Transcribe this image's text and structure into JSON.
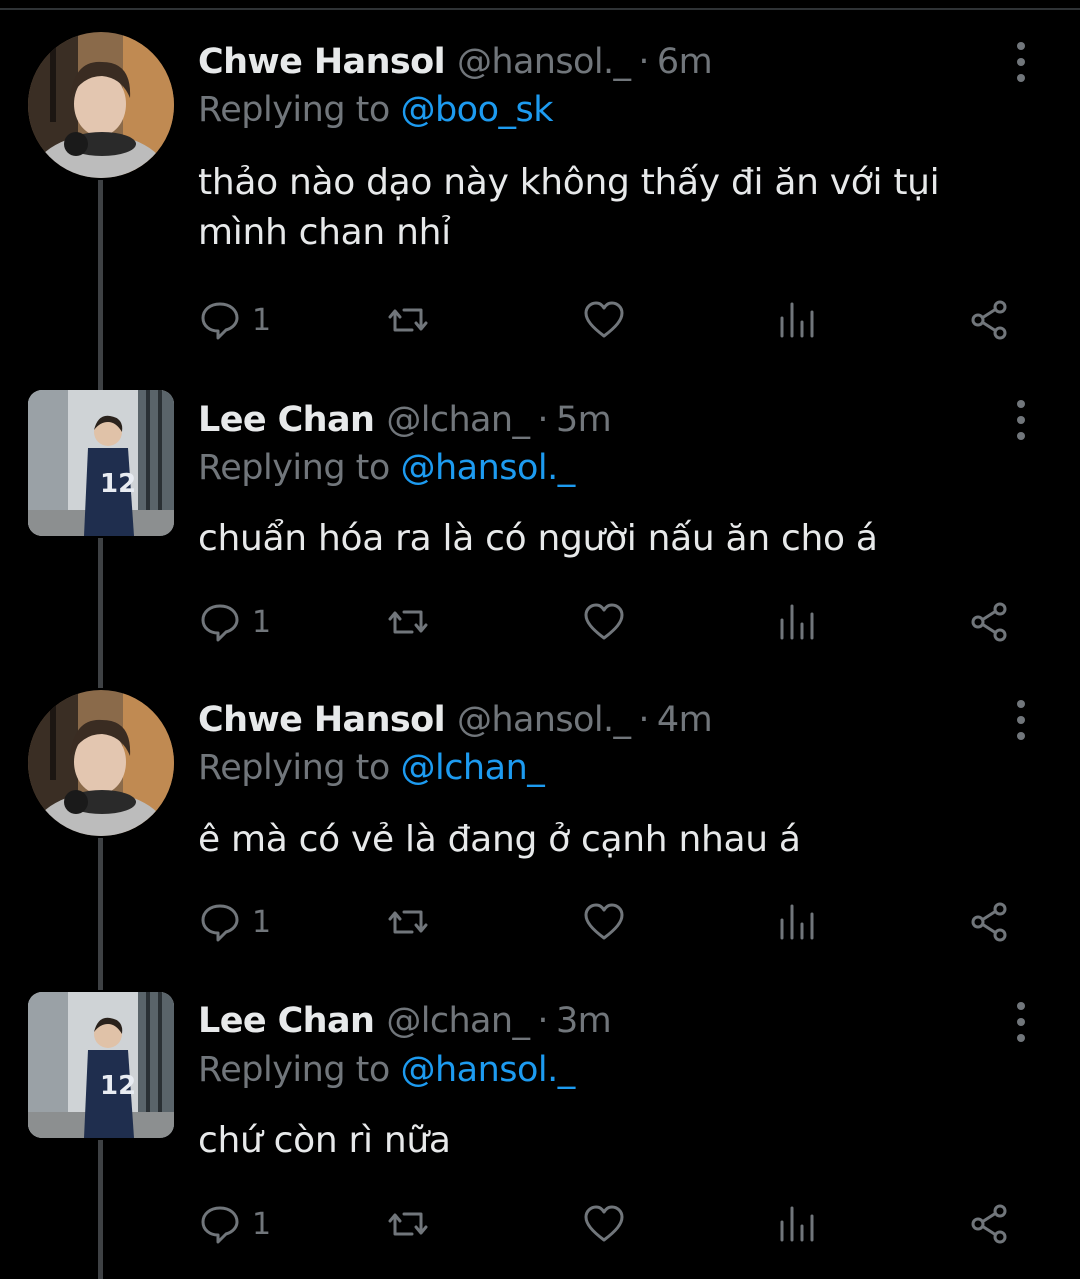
{
  "tweets": [
    {
      "name": "Chwe Hansol",
      "handle": "@hansol._",
      "separator": "·",
      "time": "6m",
      "replying_prefix": "Replying to",
      "replying_to": "@boo_sk",
      "text": "thảo nào dạo này không thấy đi ăn với tụi mình chan nhỉ",
      "reply_count": "1",
      "avatar": "hansol-avatar"
    },
    {
      "name": "Lee Chan",
      "handle": "@lchan_",
      "separator": "·",
      "time": "5m",
      "replying_prefix": "Replying to",
      "replying_to": "@hansol._",
      "text": "chuẩn hóa ra là có người nấu ăn cho á",
      "reply_count": "1",
      "avatar": "chan-avatar"
    },
    {
      "name": "Chwe Hansol",
      "handle": "@hansol._",
      "separator": "·",
      "time": "4m",
      "replying_prefix": "Replying to",
      "replying_to": "@lchan_",
      "text": "ê mà có vẻ là đang ở cạnh nhau á",
      "reply_count": "1",
      "avatar": "hansol-avatar"
    },
    {
      "name": "Lee Chan",
      "handle": "@lchan_",
      "separator": "·",
      "time": "3m",
      "replying_prefix": "Replying to",
      "replying_to": "@hansol._",
      "text": "chứ còn rì nữa",
      "reply_count": "1",
      "avatar": "chan-avatar"
    }
  ],
  "icons": {
    "reply": "reply-icon",
    "retweet": "retweet-icon",
    "like": "heart-icon",
    "views": "views-icon",
    "share": "share-icon",
    "more": "more-vertical-icon"
  },
  "colors": {
    "background": "#000000",
    "primary_text": "#e7e9ea",
    "secondary_text": "#71767b",
    "link": "#1d9bf0"
  }
}
